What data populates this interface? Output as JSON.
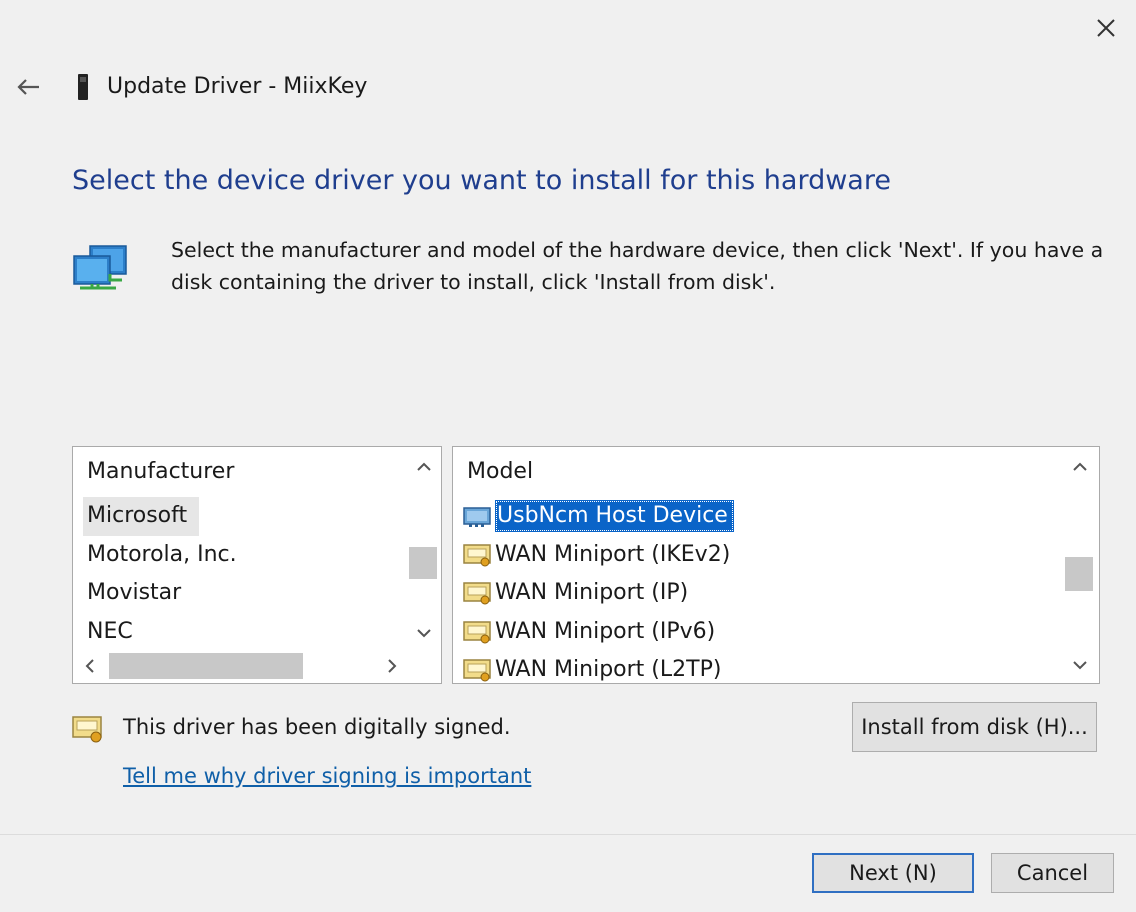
{
  "window": {
    "title": "Update Driver - MiixKey",
    "close_glyph": "✕",
    "back_glyph": "←",
    "device_icon": "usb-device-icon"
  },
  "main": {
    "heading": "Select the device driver you want to install for this hardware",
    "instructions": "Select the manufacturer and model of the hardware device, then click 'Next'. If you have a disk containing the driver to install, click 'Install from disk'.",
    "icon": "network-computers-icon"
  },
  "manufacturer_list": {
    "header": "Manufacturer",
    "items": [
      "Microsoft",
      "Motorola, Inc.",
      "Movistar",
      "NEC"
    ],
    "selected": "Microsoft"
  },
  "model_list": {
    "header": "Model",
    "items": [
      {
        "label": "UsbNcm Host Device",
        "icon": "network-adapter-icon",
        "selected": true
      },
      {
        "label": "WAN Miniport (IKEv2)",
        "icon": "certificate-icon",
        "selected": false
      },
      {
        "label": "WAN Miniport (IP)",
        "icon": "certificate-icon",
        "selected": false
      },
      {
        "label": "WAN Miniport (IPv6)",
        "icon": "certificate-icon",
        "selected": false
      },
      {
        "label": "WAN Miniport (L2TP)",
        "icon": "certificate-icon",
        "selected": false
      }
    ]
  },
  "signing": {
    "status_text": "This driver has been digitally signed.",
    "link_text": "Tell me why driver signing is important",
    "icon": "certificate-icon"
  },
  "buttons": {
    "install_from_disk": "Install from disk (H)...",
    "next": "Next (N)",
    "cancel": "Cancel"
  },
  "colors": {
    "heading": "#1f3e8e",
    "link": "#0f5fa8",
    "selection": "#0a64c8",
    "default_button_border": "#2f6fc2"
  }
}
